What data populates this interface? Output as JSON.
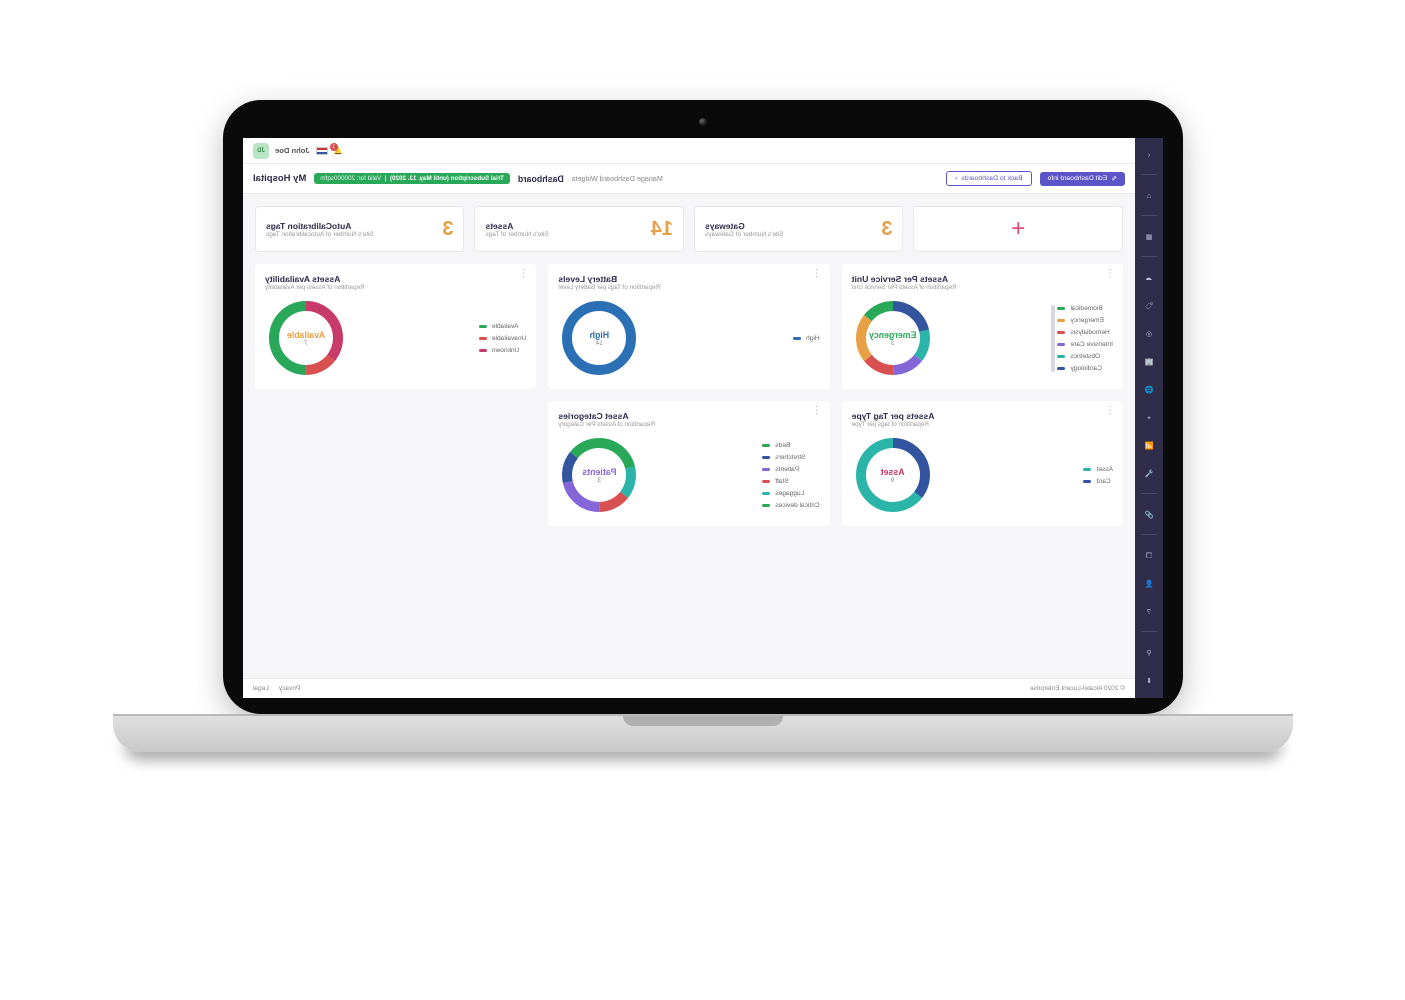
{
  "topbar": {
    "user_initials": "JD",
    "user_name": "John Doe",
    "notif_count": "1"
  },
  "subbar": {
    "hospital": "My Hospital",
    "trial_badge": "Trial Subscription (until May. 13. 2020)",
    "trial_valid": "Valid for: 200000sqfm",
    "crumb_main": "Dashboard",
    "crumb_sub": "Manage Dashboard Widgets",
    "btn_back": "Back to Dashboards",
    "btn_edit": "Edit Dashboard info"
  },
  "stats": {
    "gateways": {
      "title": "Gateways",
      "sub": "Site's Number of Gateways",
      "value": "3"
    },
    "assets": {
      "title": "Assets",
      "sub": "Site's Number of Tags",
      "value": "14"
    },
    "autocal": {
      "title": "AutoCalibration Tags",
      "sub": "Site's Number of Autocalibration Tags",
      "value": "3"
    }
  },
  "cards": {
    "service": {
      "title": "Assets Per Service Unit",
      "sub": "Repartition of Assets Per Service Unit",
      "center_label": "Emergency",
      "center_val": "3"
    },
    "battery": {
      "title": "Battery Levels",
      "sub": "Repartition of Tags per Battery Level",
      "center_label": "High",
      "center_val": "14"
    },
    "avail": {
      "title": "Assets Availability",
      "sub": "Repartition of Assets per Availability",
      "center_label": "Available",
      "center_val": "7"
    },
    "tagtype": {
      "title": "Assets per Tag Type",
      "sub": "Repartition of tags per Type",
      "center_label": "Asset",
      "center_val": "9"
    },
    "category": {
      "title": "Asset Categories",
      "sub": "Repartition of Assets Per Category",
      "center_label": "Patients",
      "center_val": "3"
    }
  },
  "legends": {
    "service": [
      {
        "label": "Biomedical",
        "color": "#2aa85a"
      },
      {
        "label": "Emergency",
        "color": "#e8a046"
      },
      {
        "label": "Hemodialysis",
        "color": "#d95050"
      },
      {
        "label": "Intensive Care",
        "color": "#8566d9"
      },
      {
        "label": "Obstetrics",
        "color": "#2bb5a8"
      },
      {
        "label": "Cardiology",
        "color": "#3355a0"
      }
    ],
    "battery": [
      {
        "label": "High",
        "color": "#2b6fb5"
      }
    ],
    "avail": [
      {
        "label": "Available",
        "color": "#2aa85a"
      },
      {
        "label": "Unavailable",
        "color": "#d95050"
      },
      {
        "label": "Unknown",
        "color": "#c83a68"
      }
    ],
    "tagtype": [
      {
        "label": "Asset",
        "color": "#2bb5a8"
      },
      {
        "label": "Card",
        "color": "#3355a0"
      }
    ],
    "category": [
      {
        "label": "Beds",
        "color": "#2aa85a"
      },
      {
        "label": "Stretchers",
        "color": "#3355a0"
      },
      {
        "label": "Patients",
        "color": "#8566d9"
      },
      {
        "label": "Staff",
        "color": "#d95050"
      },
      {
        "label": "Luggages",
        "color": "#2bb5a8"
      },
      {
        "label": "Critical devices",
        "color": "#2aa85a"
      }
    ]
  },
  "footer": {
    "legal": "Legal",
    "privacy": "Privacy",
    "copy": "© 2020 Alcatel-Lucent Enterprise"
  },
  "chart_data": [
    {
      "type": "pie",
      "id": "service",
      "title": "Assets Per Service Unit",
      "series": [
        {
          "name": "Biomedical",
          "value": 2,
          "color": "#2aa85a"
        },
        {
          "name": "Emergency",
          "value": 3,
          "color": "#e8a046"
        },
        {
          "name": "Hemodialysis",
          "value": 2,
          "color": "#d95050"
        },
        {
          "name": "Intensive Care",
          "value": 2,
          "color": "#8566d9"
        },
        {
          "name": "Obstetrics",
          "value": 2,
          "color": "#2bb5a8"
        },
        {
          "name": "Cardiology",
          "value": 3,
          "color": "#3355a0"
        }
      ],
      "highlight": {
        "name": "Emergency",
        "value": 3
      }
    },
    {
      "type": "pie",
      "id": "battery",
      "title": "Battery Levels",
      "series": [
        {
          "name": "High",
          "value": 14,
          "color": "#2b6fb5"
        }
      ],
      "highlight": {
        "name": "High",
        "value": 14
      }
    },
    {
      "type": "pie",
      "id": "avail",
      "title": "Assets Availability",
      "series": [
        {
          "name": "Available",
          "value": 7,
          "color": "#2aa85a"
        },
        {
          "name": "Unavailable",
          "value": 2,
          "color": "#d95050"
        },
        {
          "name": "Unknown",
          "value": 5,
          "color": "#c83a68"
        }
      ],
      "highlight": {
        "name": "Available",
        "value": 7
      }
    },
    {
      "type": "pie",
      "id": "tagtype",
      "title": "Assets per Tag Type",
      "series": [
        {
          "name": "Asset",
          "value": 9,
          "color": "#2bb5a8"
        },
        {
          "name": "Card",
          "value": 5,
          "color": "#3355a0"
        }
      ],
      "highlight": {
        "name": "Asset",
        "value": 9
      }
    },
    {
      "type": "pie",
      "id": "category",
      "title": "Asset Categories",
      "series": [
        {
          "name": "Beds",
          "value": 2,
          "color": "#2aa85a"
        },
        {
          "name": "Stretchers",
          "value": 2,
          "color": "#3355a0"
        },
        {
          "name": "Patients",
          "value": 3,
          "color": "#8566d9"
        },
        {
          "name": "Staff",
          "value": 2,
          "color": "#d95050"
        },
        {
          "name": "Luggages",
          "value": 2,
          "color": "#2bb5a8"
        },
        {
          "name": "Critical devices",
          "value": 3,
          "color": "#2aa85a"
        }
      ],
      "highlight": {
        "name": "Patients",
        "value": 3
      }
    }
  ]
}
